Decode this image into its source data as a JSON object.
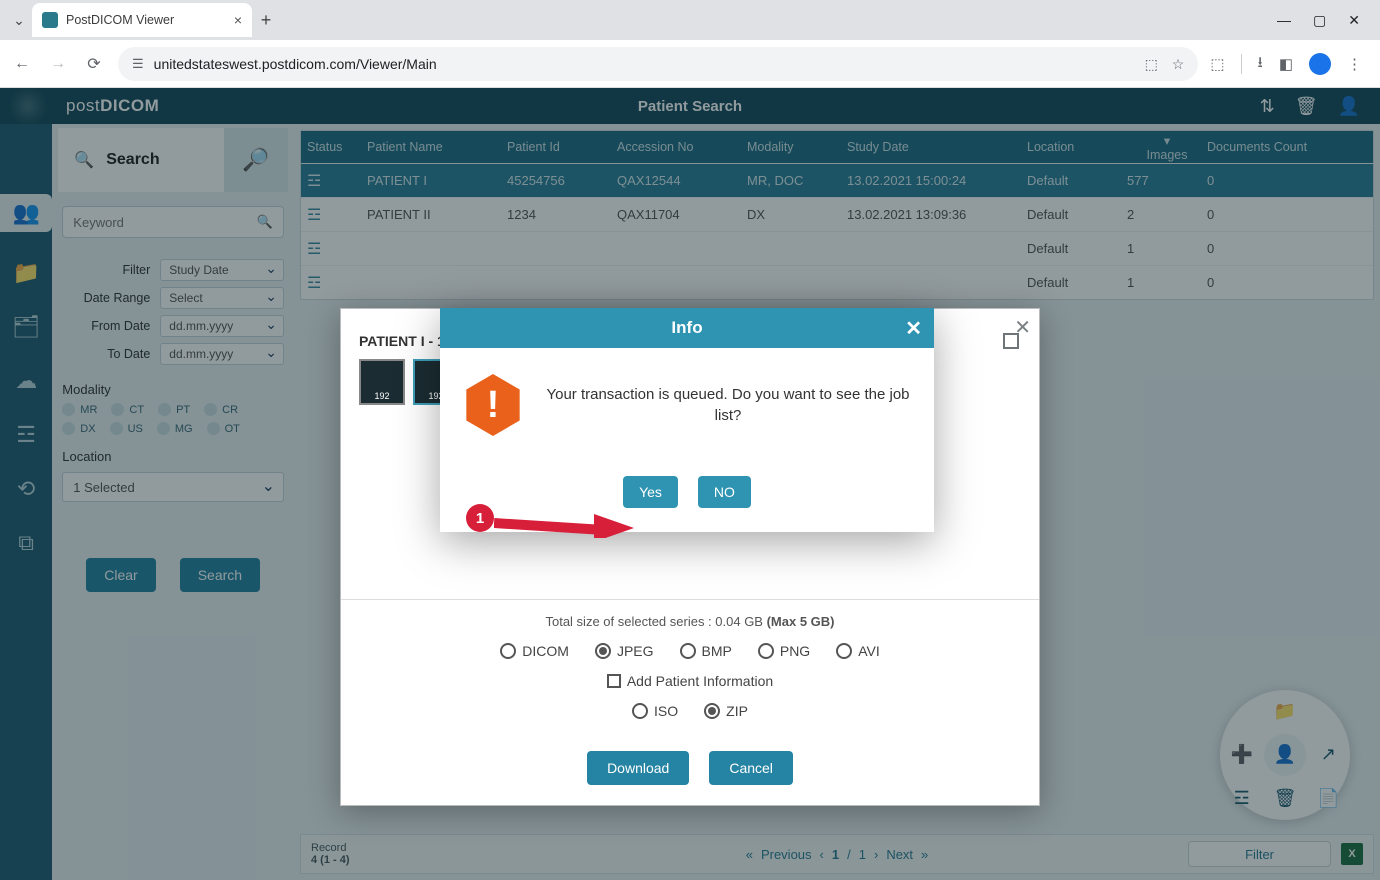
{
  "browser": {
    "tab_title": "PostDICOM Viewer",
    "url": "unitedstateswest.postdicom.com/Viewer/Main"
  },
  "header": {
    "brand_prefix": "post",
    "brand_bold": "DICOM",
    "page_title": "Patient Search"
  },
  "sidebar": {
    "search_label": "Search",
    "keyword_placeholder": "Keyword",
    "filters": {
      "filter_label": "Filter",
      "filter_value": "Study Date",
      "date_range_label": "Date Range",
      "date_range_value": "Select",
      "from_label": "From Date",
      "from_value": "dd.mm.yyyy",
      "to_label": "To Date",
      "to_value": "dd.mm.yyyy"
    },
    "modality_label": "Modality",
    "modalities": [
      "MR",
      "CT",
      "PT",
      "CR",
      "DX",
      "US",
      "MG",
      "OT"
    ],
    "location_label": "Location",
    "location_value": "1 Selected",
    "clear_btn": "Clear",
    "search_btn": "Search"
  },
  "table": {
    "headers": [
      "Status",
      "Patient Name",
      "Patient Id",
      "Accession No",
      "Modality",
      "Study Date",
      "Location",
      "Images",
      "Documents Count"
    ],
    "rows": [
      {
        "name": "PATIENT I",
        "pid": "45254756",
        "acc": "QAX12544",
        "mod": "MR, DOC",
        "date": "13.02.2021 15:00:24",
        "loc": "Default",
        "img": "577",
        "docs": "0",
        "selected": true
      },
      {
        "name": "PATIENT II",
        "pid": "1234",
        "acc": "QAX11704",
        "mod": "DX",
        "date": "13.02.2021 13:09:36",
        "loc": "Default",
        "img": "2",
        "docs": "0"
      },
      {
        "name": "",
        "pid": "",
        "acc": "",
        "mod": "",
        "date": "",
        "loc": "Default",
        "img": "1",
        "docs": "0"
      },
      {
        "name": "",
        "pid": "",
        "acc": "",
        "mod": "",
        "date": "",
        "loc": "Default",
        "img": "1",
        "docs": "0"
      }
    ]
  },
  "download_modal": {
    "series_title": "PATIENT I - 13",
    "thumb1_count": "192",
    "thumb2_count": "192",
    "size_text": "Total size of selected series : 0.04 GB ",
    "size_max": "(Max 5 GB)",
    "formats": {
      "dicom": "DICOM",
      "jpeg": "JPEG",
      "bmp": "BMP",
      "png": "PNG",
      "avi": "AVI"
    },
    "add_patient_info": "Add Patient Information",
    "archive": {
      "iso": "ISO",
      "zip": "ZIP"
    },
    "download_btn": "Download",
    "cancel_btn": "Cancel"
  },
  "info_dialog": {
    "title": "Info",
    "message": "Your transaction is queued. Do you want to see the job list?",
    "yes": "Yes",
    "no": "NO"
  },
  "annotation": {
    "bubble": "1"
  },
  "footer": {
    "record_label": "Record",
    "record_value": "4 (1 - 4)",
    "previous": "Previous",
    "page_current": "1",
    "page_sep": "/",
    "page_total": "1",
    "next": "Next",
    "filter_btn": "Filter"
  }
}
